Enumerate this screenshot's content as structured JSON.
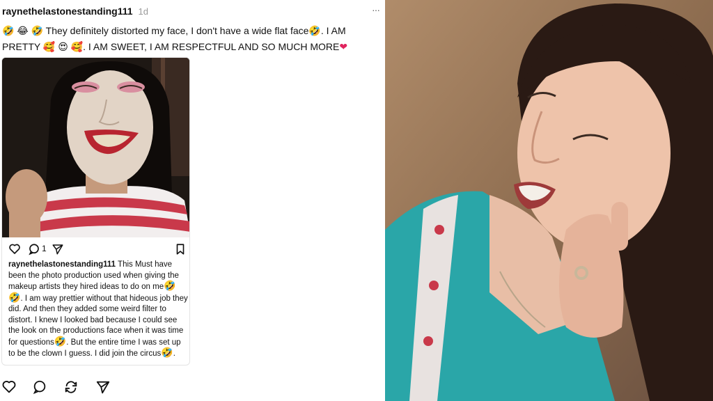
{
  "post": {
    "username": "raynethelastonestanding111",
    "timestamp": "1d",
    "text_line1_a": "They definitely distorted my face, I don't have a wide flat face",
    "text_line1_b": ". I AM",
    "text_line2_a": "PRETTY",
    "text_line2_b": ". I AM SWEET, I AM RESPECTFUL AND SO MUCH MORE",
    "emoji_laugh": "🤣",
    "emoji_grin": "😂",
    "emoji_love": "🥰",
    "emoji_heart_eyes": "😍",
    "emoji_heart": "❤",
    "icons": [
      "heart-icon",
      "comment-icon",
      "repost-icon",
      "share-icon"
    ]
  },
  "card": {
    "comment_count": "1",
    "caption_user": "raynethelastonestanding111",
    "caption_a": "This Must have been the photo production used when giving the makeup artists they hired ideas to do on me",
    "caption_b": ". I am way prettier without that hideous job they did. And then they added some weird filter to distort. I knew I looked bad because I could see the look on the productions face when it was time for questions",
    "caption_c": ". But the entire time I was set up to be the clown I guess. I did join the circus",
    "caption_d": ".",
    "icons": [
      "heart-icon",
      "comment-icon",
      "share-icon",
      "bookmark-icon"
    ]
  },
  "colors": {
    "card_border": "#e3e3e3",
    "muted_text": "#999999",
    "teal_top": "#2aa6a8",
    "stripe_red": "#c9394a"
  }
}
